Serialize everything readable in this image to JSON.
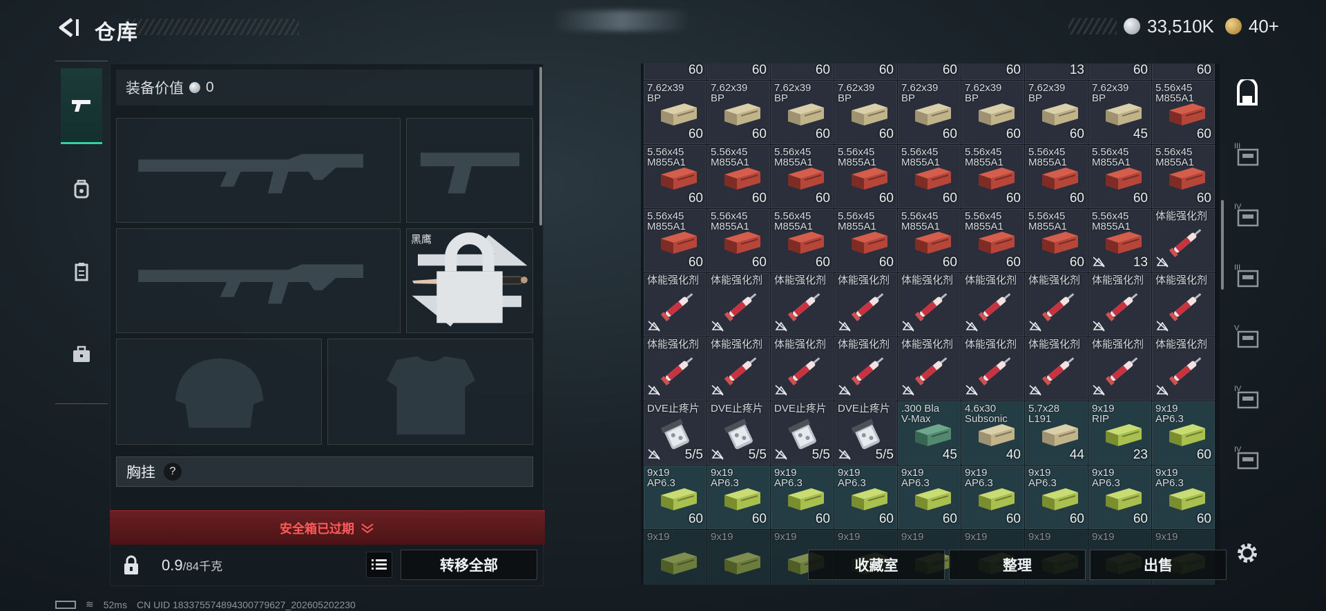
{
  "header": {
    "title": "仓库"
  },
  "currency": {
    "silver": "33,510K",
    "gold": "40+"
  },
  "loadout": {
    "value_label": "装备价值",
    "value": "0",
    "knife_name": "黑鹰",
    "chest_label": "胸挂",
    "chest_help": "?",
    "warning": "安全箱已过期",
    "weight_current": "0.9",
    "weight_max": "/84千克",
    "transfer_all": "转移全部"
  },
  "inventory": {
    "rows": [
      [
        {
          "name": "",
          "count": "60",
          "style": "ammo-tan"
        },
        {
          "name": "",
          "count": "60",
          "style": "ammo-tan"
        },
        {
          "name": "",
          "count": "60",
          "style": "ammo-tan"
        },
        {
          "name": "",
          "count": "60",
          "style": "ammo-tan"
        },
        {
          "name": "",
          "count": "60",
          "style": "ammo-tan"
        },
        {
          "name": "",
          "count": "60",
          "style": "ammo-tan"
        },
        {
          "name": "",
          "count": "13",
          "style": "ammo-tan"
        },
        {
          "name": "",
          "count": "60",
          "style": "ammo-tan"
        },
        {
          "name": "",
          "count": "60",
          "style": "ammo-tan"
        }
      ],
      [
        {
          "name": "7.62x39\nBP",
          "count": "60",
          "style": "ammo-tan"
        },
        {
          "name": "7.62x39\nBP",
          "count": "60",
          "style": "ammo-tan"
        },
        {
          "name": "7.62x39\nBP",
          "count": "60",
          "style": "ammo-tan"
        },
        {
          "name": "7.62x39\nBP",
          "count": "60",
          "style": "ammo-tan"
        },
        {
          "name": "7.62x39\nBP",
          "count": "60",
          "style": "ammo-tan"
        },
        {
          "name": "7.62x39\nBP",
          "count": "60",
          "style": "ammo-tan"
        },
        {
          "name": "7.62x39\nBP",
          "count": "60",
          "style": "ammo-tan"
        },
        {
          "name": "7.62x39\nBP",
          "count": "45",
          "style": "ammo-tan"
        },
        {
          "name": "5.56x45\nM855A1",
          "count": "60",
          "style": "ammo-red"
        }
      ],
      [
        {
          "name": "5.56x45\nM855A1",
          "count": "60",
          "style": "ammo-red"
        },
        {
          "name": "5.56x45\nM855A1",
          "count": "60",
          "style": "ammo-red"
        },
        {
          "name": "5.56x45\nM855A1",
          "count": "60",
          "style": "ammo-red"
        },
        {
          "name": "5.56x45\nM855A1",
          "count": "60",
          "style": "ammo-red"
        },
        {
          "name": "5.56x45\nM855A1",
          "count": "60",
          "style": "ammo-red"
        },
        {
          "name": "5.56x45\nM855A1",
          "count": "60",
          "style": "ammo-red"
        },
        {
          "name": "5.56x45\nM855A1",
          "count": "60",
          "style": "ammo-red"
        },
        {
          "name": "5.56x45\nM855A1",
          "count": "60",
          "style": "ammo-red"
        },
        {
          "name": "5.56x45\nM855A1",
          "count": "60",
          "style": "ammo-red"
        }
      ],
      [
        {
          "name": "5.56x45\nM855A1",
          "count": "60",
          "style": "ammo-red"
        },
        {
          "name": "5.56x45\nM855A1",
          "count": "60",
          "style": "ammo-red"
        },
        {
          "name": "5.56x45\nM855A1",
          "count": "60",
          "style": "ammo-red"
        },
        {
          "name": "5.56x45\nM855A1",
          "count": "60",
          "style": "ammo-red"
        },
        {
          "name": "5.56x45\nM855A1",
          "count": "60",
          "style": "ammo-red"
        },
        {
          "name": "5.56x45\nM855A1",
          "count": "60",
          "style": "ammo-red"
        },
        {
          "name": "5.56x45\nM855A1",
          "count": "60",
          "style": "ammo-red"
        },
        {
          "name": "5.56x45\nM855A1",
          "count": "13",
          "style": "ammo-red",
          "nobuy": true
        },
        {
          "name": "体能强化剂",
          "count": "",
          "style": "syringe",
          "nobuy": true
        }
      ],
      [
        {
          "name": "体能强化剂",
          "count": "",
          "style": "syringe",
          "nobuy": true
        },
        {
          "name": "体能强化剂",
          "count": "",
          "style": "syringe",
          "nobuy": true
        },
        {
          "name": "体能强化剂",
          "count": "",
          "style": "syringe",
          "nobuy": true
        },
        {
          "name": "体能强化剂",
          "count": "",
          "style": "syringe",
          "nobuy": true
        },
        {
          "name": "体能强化剂",
          "count": "",
          "style": "syringe",
          "nobuy": true
        },
        {
          "name": "体能强化剂",
          "count": "",
          "style": "syringe",
          "nobuy": true
        },
        {
          "name": "体能强化剂",
          "count": "",
          "style": "syringe",
          "nobuy": true
        },
        {
          "name": "体能强化剂",
          "count": "",
          "style": "syringe",
          "nobuy": true
        },
        {
          "name": "体能强化剂",
          "count": "",
          "style": "syringe",
          "nobuy": true
        }
      ],
      [
        {
          "name": "体能强化剂",
          "count": "",
          "style": "syringe",
          "nobuy": true
        },
        {
          "name": "体能强化剂",
          "count": "",
          "style": "syringe",
          "nobuy": true
        },
        {
          "name": "体能强化剂",
          "count": "",
          "style": "syringe",
          "nobuy": true
        },
        {
          "name": "体能强化剂",
          "count": "",
          "style": "syringe",
          "nobuy": true
        },
        {
          "name": "体能强化剂",
          "count": "",
          "style": "syringe",
          "nobuy": true
        },
        {
          "name": "体能强化剂",
          "count": "",
          "style": "syringe",
          "nobuy": true
        },
        {
          "name": "体能强化剂",
          "count": "",
          "style": "syringe",
          "nobuy": true
        },
        {
          "name": "体能强化剂",
          "count": "",
          "style": "syringe",
          "nobuy": true
        },
        {
          "name": "体能强化剂",
          "count": "",
          "style": "syringe",
          "nobuy": true
        }
      ],
      [
        {
          "name": "DVE止疼片",
          "count": "5/5",
          "style": "pills",
          "nobuy": true
        },
        {
          "name": "DVE止疼片",
          "count": "5/5",
          "style": "pills",
          "nobuy": true
        },
        {
          "name": "DVE止疼片",
          "count": "5/5",
          "style": "pills",
          "nobuy": true
        },
        {
          "name": "DVE止疼片",
          "count": "5/5",
          "style": "pills",
          "nobuy": true
        },
        {
          "name": ".300 Bla\nV-Max",
          "count": "45",
          "style": "ammo-teal",
          "teal": true
        },
        {
          "name": "4.6x30\nSubsonic",
          "count": "40",
          "style": "ammo-tan",
          "teal": true
        },
        {
          "name": "5.7x28\nL191",
          "count": "44",
          "style": "ammo-tan",
          "teal": true
        },
        {
          "name": "9x19\nRIP",
          "count": "23",
          "style": "ammo-green",
          "teal": true
        },
        {
          "name": "9x19\nAP6.3",
          "count": "60",
          "style": "ammo-green",
          "teal": true
        }
      ],
      [
        {
          "name": "9x19\nAP6.3",
          "count": "60",
          "style": "ammo-green",
          "teal": true
        },
        {
          "name": "9x19\nAP6.3",
          "count": "60",
          "style": "ammo-green",
          "teal": true
        },
        {
          "name": "9x19\nAP6.3",
          "count": "60",
          "style": "ammo-green",
          "teal": true
        },
        {
          "name": "9x19\nAP6.3",
          "count": "60",
          "style": "ammo-green",
          "teal": true
        },
        {
          "name": "9x19\nAP6.3",
          "count": "60",
          "style": "ammo-green",
          "teal": true
        },
        {
          "name": "9x19\nAP6.3",
          "count": "60",
          "style": "ammo-green",
          "teal": true
        },
        {
          "name": "9x19\nAP6.3",
          "count": "60",
          "style": "ammo-green",
          "teal": true
        },
        {
          "name": "9x19\nAP6.3",
          "count": "60",
          "style": "ammo-green",
          "teal": true
        },
        {
          "name": "9x19\nAP6.3",
          "count": "60",
          "style": "ammo-green",
          "teal": true
        }
      ],
      [
        {
          "name": "9x19",
          "count": "",
          "style": "ammo-green",
          "teal": true,
          "faded": true
        },
        {
          "name": "9x19",
          "count": "",
          "style": "ammo-green",
          "teal": true,
          "faded": true
        },
        {
          "name": "9x19",
          "count": "",
          "style": "ammo-green",
          "teal": true,
          "faded": true
        },
        {
          "name": "9x19",
          "count": "",
          "style": "ammo-green",
          "teal": true,
          "faded": true
        },
        {
          "name": "9x19",
          "count": "",
          "style": "ammo-green",
          "teal": true,
          "faded": true
        },
        {
          "name": "9x19",
          "count": "",
          "style": "ammo-green",
          "teal": true,
          "faded": true
        },
        {
          "name": "9x19",
          "count": "",
          "style": "ammo-green",
          "teal": true,
          "faded": true
        },
        {
          "name": "9x19",
          "count": "",
          "style": "ammo-green",
          "teal": true,
          "faded": true
        },
        {
          "name": "9x19",
          "count": "",
          "style": "ammo-green",
          "teal": true,
          "faded": true
        }
      ]
    ]
  },
  "right_rail": [
    {
      "icon": "backpack-icon",
      "label": ""
    },
    {
      "icon": "crate-tier-3-icon",
      "label": "III"
    },
    {
      "icon": "crate-tier-4-icon",
      "label": "IV"
    },
    {
      "icon": "crate-tier-3b-icon",
      "label": "III"
    },
    {
      "icon": "crate-tier-5-icon",
      "label": "V"
    },
    {
      "icon": "crate-tier-4b-icon",
      "label": "IV"
    },
    {
      "icon": "crate-tier-4c-icon",
      "label": "IV"
    }
  ],
  "actions": {
    "collection": "收藏室",
    "organize": "整理",
    "sell": "出售"
  },
  "status": {
    "ping": "52ms",
    "uid": "CN UID 18337557489430077962​7_202605202230"
  },
  "colors": {
    "accent": "#2fd3a6",
    "warning": "#ff5b5b",
    "cell_bg": "#2b2f3b",
    "cell_teal": "#243c44"
  }
}
